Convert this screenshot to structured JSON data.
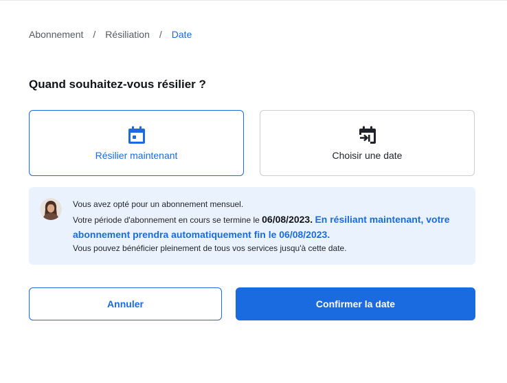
{
  "breadcrumb": {
    "items": [
      "Abonnement",
      "Résiliation",
      "Date"
    ],
    "separator": "/"
  },
  "title": "Quand souhaitez-vous résilier ?",
  "options": [
    {
      "label": "Résilier maintenant",
      "icon": "calendar-icon",
      "selected": true
    },
    {
      "label": "Choisir une date",
      "icon": "calendar-arrow-icon",
      "selected": false
    }
  ],
  "info": {
    "line1": "Vous avez opté pour un abonnement mensuel.",
    "line2_prefix": "Votre période d'abonnement en cours se termine le ",
    "end_date": "06/08/2023.",
    "line2_highlight": "En résiliant maintenant, votre abonnement prendra automatiquement fin le 06/08/2023.",
    "line3": "Vous pouvez bénéficier pleinement de tous vos services jusqu'à cette date.",
    "avatar_icon": "advisor-avatar"
  },
  "buttons": {
    "cancel": "Annuler",
    "confirm": "Confirmer la date"
  },
  "colors": {
    "accent": "#1a6ae0",
    "info_background": "#eaf3fd"
  }
}
